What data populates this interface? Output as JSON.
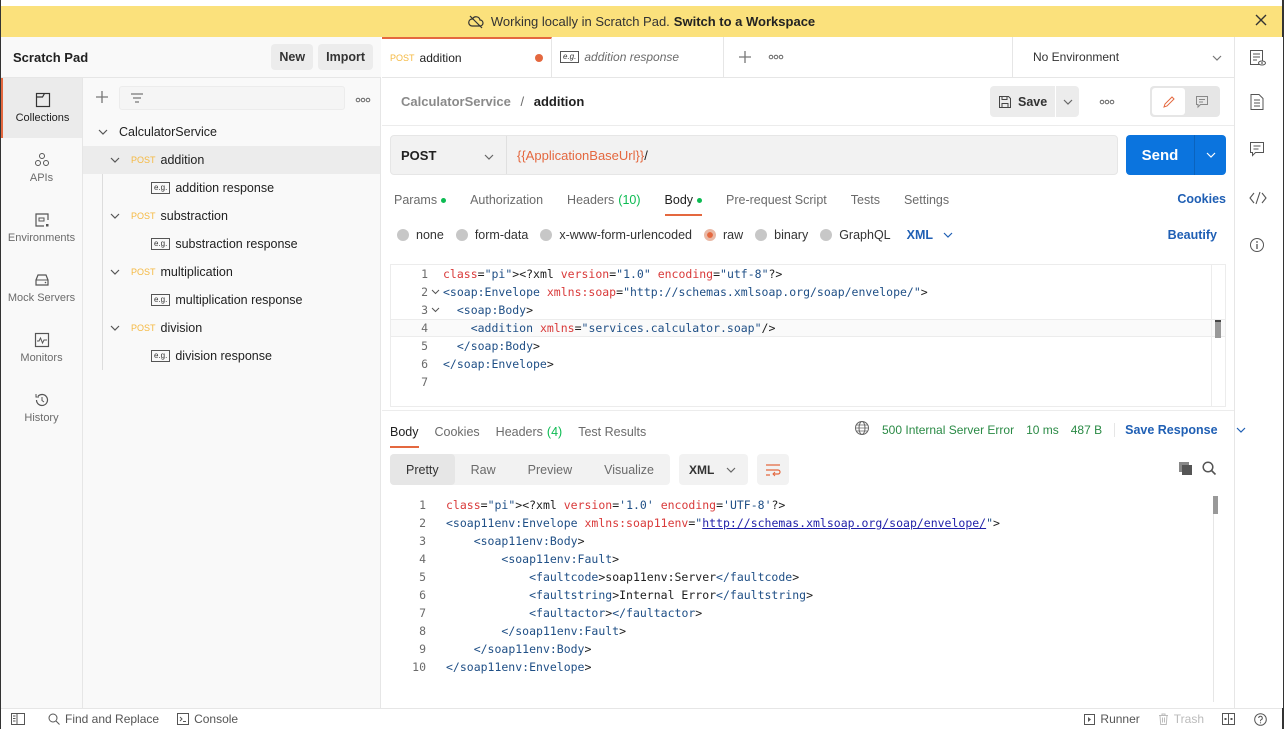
{
  "banner": {
    "text": "Working locally in Scratch Pad.",
    "link": "Switch to a Workspace"
  },
  "sidebar_header": {
    "title": "Scratch Pad",
    "new_label": "New",
    "import_label": "Import"
  },
  "rail": {
    "items": [
      {
        "label": "Collections",
        "icon": "collections-icon",
        "active": true
      },
      {
        "label": "APIs",
        "icon": "apis-icon"
      },
      {
        "label": "Environments",
        "icon": "environments-icon"
      },
      {
        "label": "Mock Servers",
        "icon": "mock-servers-icon"
      },
      {
        "label": "Monitors",
        "icon": "monitors-icon"
      },
      {
        "label": "History",
        "icon": "history-icon"
      }
    ]
  },
  "tree": {
    "collection": "CalculatorService",
    "requests": [
      {
        "method": "POST",
        "name": "addition",
        "example": "addition response",
        "selected": true
      },
      {
        "method": "POST",
        "name": "substraction",
        "example": "substraction response"
      },
      {
        "method": "POST",
        "name": "multiplication",
        "example": "multiplication response"
      },
      {
        "method": "POST",
        "name": "division",
        "example": "division response"
      }
    ],
    "example_badge": "e.g."
  },
  "tabs": {
    "active": {
      "method": "POST",
      "name": "addition"
    },
    "second": {
      "name": "addition response",
      "badge": "e.g."
    }
  },
  "environment": {
    "selected": "No Environment"
  },
  "request": {
    "breadcrumb": {
      "collection": "CalculatorService",
      "separator": "/",
      "name": "addition"
    },
    "save_label": "Save",
    "method": "POST",
    "url_variable": "{{ApplicationBaseUrl}}",
    "url_suffix": "/",
    "send_label": "Send",
    "tabs": [
      {
        "label": "Params",
        "dot": true
      },
      {
        "label": "Authorization"
      },
      {
        "label": "Headers",
        "count": "(10)"
      },
      {
        "label": "Body",
        "dot": true,
        "active": true
      },
      {
        "label": "Pre-request Script"
      },
      {
        "label": "Tests"
      },
      {
        "label": "Settings"
      }
    ],
    "cookies_label": "Cookies",
    "body_types": [
      {
        "label": "none"
      },
      {
        "label": "form-data"
      },
      {
        "label": "x-www-form-urlencoded"
      },
      {
        "label": "raw",
        "selected": true
      },
      {
        "label": "binary"
      },
      {
        "label": "GraphQL"
      }
    ],
    "raw_format": "XML",
    "beautify_label": "Beautify",
    "body_lines": [
      "<?xml version=\"1.0\" encoding=\"utf-8\"?>",
      "<soap:Envelope xmlns:soap=\"http://schemas.xmlsoap.org/soap/envelope/\">",
      "  <soap:Body>",
      "    <addition xmlns=\"services.calculator.soap\"/>",
      "  </soap:Body>",
      "</soap:Envelope>",
      ""
    ]
  },
  "response": {
    "tabs": [
      {
        "label": "Body",
        "active": true
      },
      {
        "label": "Cookies"
      },
      {
        "label": "Headers",
        "count": "(4)"
      },
      {
        "label": "Test Results"
      }
    ],
    "status": "500 Internal Server Error",
    "time": "10 ms",
    "size": "487 B",
    "save_label": "Save Response",
    "views": [
      "Pretty",
      "Raw",
      "Preview",
      "Visualize"
    ],
    "active_view": "Pretty",
    "format": "XML",
    "body_lines": [
      "<?xml version='1.0' encoding='UTF-8'?>",
      "<soap11env:Envelope xmlns:soap11env=\"http://schemas.xmlsoap.org/soap/envelope/\">",
      "    <soap11env:Body>",
      "        <soap11env:Fault>",
      "            <faultcode>soap11env:Server</faultcode>",
      "            <faultstring>Internal Error</faultstring>",
      "            <faultactor></faultactor>",
      "        </soap11env:Fault>",
      "    </soap11env:Body>",
      "</soap11env:Envelope>"
    ]
  },
  "footer": {
    "find_replace": "Find and Replace",
    "console": "Console",
    "runner": "Runner",
    "trash": "Trash"
  },
  "colors": {
    "accent": "#e4683f",
    "primary": "#0b74de",
    "banner": "#fbe17c",
    "success": "#0cbb52",
    "link": "#1f5fb4"
  }
}
